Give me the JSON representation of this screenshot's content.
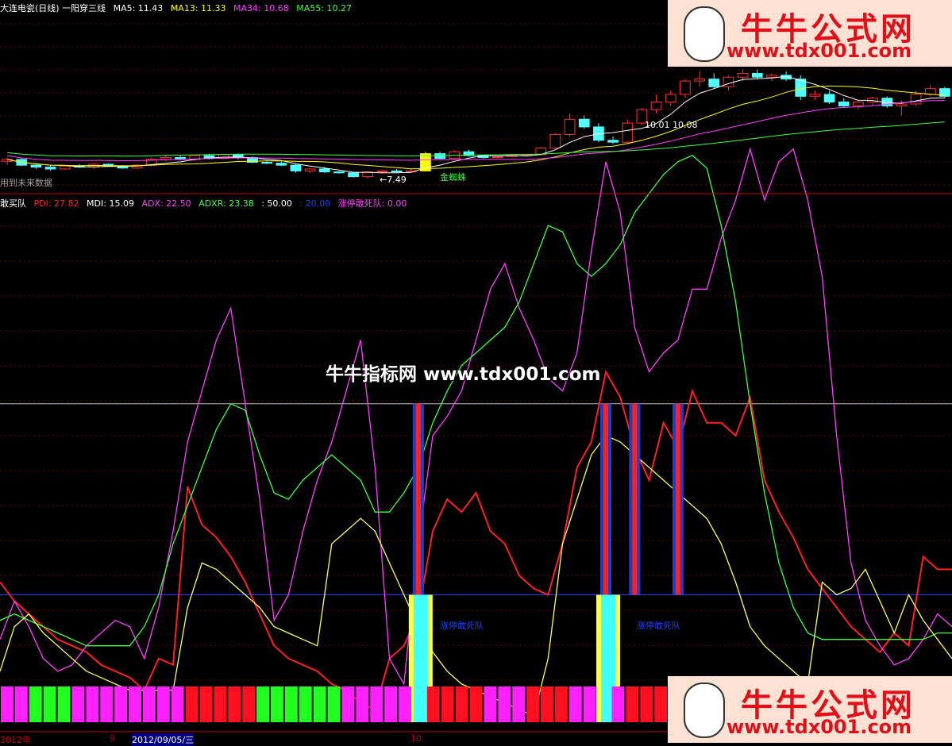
{
  "upper_header": {
    "title": "大连电瓷(日线) 一阳穿三线",
    "ma5": "MA5: 11.43",
    "ma13": "MA13: 11.33",
    "ma34": "MA34: 10.68",
    "ma55": "MA55: 10.27"
  },
  "lower_header": {
    "name": "敢买队",
    "pdi": "PDI: 27.82",
    "mdi": "MDI: 15.09",
    "adx": "ADX: 22.50",
    "adxr": "ADXR: 23.38",
    "v50": ": 50.00",
    "v20": ": 20.00",
    "zt": "涨停敢死队: 0.00"
  },
  "note": "用到未来数据",
  "annotations": {
    "low_price": "←7.49",
    "spider": "金蜘蛛",
    "price_mark": "10.01 10.08",
    "zt_label_1": "涨停敢死队",
    "zt_label_2": "涨停敢死队"
  },
  "watermark": "牛牛指标网 www.tdx001.com",
  "logo": {
    "title": "牛牛公式网",
    "url": "www.tdx001.com"
  },
  "x_axis": {
    "year": "2012年",
    "m9": "9",
    "date": "2012/09/05/三",
    "m10": "10"
  },
  "colors": {
    "bg": "#000000",
    "pdi": "#ff2020",
    "mdi": "#ff40ff",
    "adx": "#40ff40",
    "adxr": "#ffff60",
    "ma5": "#ffffff",
    "ma13": "#ffff00",
    "ma34": "#ff40ff",
    "ma55": "#40ff40",
    "grid": "#800000"
  },
  "chart_data": [
    {
      "type": "candlestick",
      "title": "大连电瓷(日线) 一阳穿三线",
      "candles": [
        [
          8.1,
          8.3,
          7.9,
          8.2
        ],
        [
          8.2,
          8.3,
          7.85,
          7.9
        ],
        [
          7.9,
          8.0,
          7.7,
          7.8
        ],
        [
          7.8,
          7.9,
          7.6,
          7.7
        ],
        [
          7.7,
          7.9,
          7.65,
          7.85
        ],
        [
          7.85,
          7.95,
          7.75,
          7.8
        ],
        [
          7.8,
          8.0,
          7.7,
          7.95
        ],
        [
          7.95,
          8.0,
          7.8,
          7.85
        ],
        [
          7.85,
          7.9,
          7.7,
          7.75
        ],
        [
          7.75,
          7.95,
          7.7,
          7.9
        ],
        [
          7.9,
          8.3,
          7.85,
          8.2
        ],
        [
          8.2,
          8.4,
          8.1,
          8.3
        ],
        [
          8.3,
          8.4,
          8.15,
          8.2
        ],
        [
          8.2,
          8.45,
          8.15,
          8.4
        ],
        [
          8.4,
          8.5,
          8.2,
          8.25
        ],
        [
          8.25,
          8.5,
          8.2,
          8.45
        ],
        [
          8.45,
          8.5,
          8.2,
          8.3
        ],
        [
          8.3,
          8.35,
          8.0,
          8.05
        ],
        [
          8.05,
          8.15,
          7.95,
          8.0
        ],
        [
          8.0,
          8.1,
          7.85,
          7.9
        ],
        [
          7.9,
          8.0,
          7.5,
          7.6
        ],
        [
          7.6,
          7.75,
          7.5,
          7.7
        ],
        [
          7.7,
          7.8,
          7.5,
          7.55
        ],
        [
          7.55,
          7.6,
          7.45,
          7.5
        ],
        [
          7.5,
          7.55,
          7.25,
          7.3
        ],
        [
          7.3,
          7.6,
          7.2,
          7.55
        ],
        [
          7.55,
          7.65,
          7.45,
          7.6
        ],
        [
          7.6,
          7.7,
          7.49,
          7.55
        ],
        [
          7.55,
          7.7,
          7.5,
          7.6
        ],
        [
          7.6,
          8.6,
          7.6,
          8.5
        ],
        [
          8.5,
          8.6,
          8.2,
          8.25
        ],
        [
          8.25,
          8.7,
          8.2,
          8.6
        ],
        [
          8.6,
          8.7,
          8.35,
          8.4
        ],
        [
          8.4,
          8.45,
          8.25,
          8.3
        ],
        [
          8.3,
          8.4,
          8.25,
          8.35
        ],
        [
          8.35,
          8.45,
          8.3,
          8.4
        ],
        [
          8.4,
          8.5,
          8.35,
          8.45
        ],
        [
          8.45,
          8.85,
          8.4,
          8.8
        ],
        [
          8.8,
          9.6,
          8.75,
          9.5
        ],
        [
          9.5,
          10.6,
          9.4,
          10.3
        ],
        [
          10.3,
          10.5,
          9.8,
          9.9
        ],
        [
          9.9,
          10.1,
          9.1,
          9.2
        ],
        [
          9.2,
          9.4,
          9.0,
          9.1
        ],
        [
          9.1,
          10.3,
          9.05,
          10.1
        ],
        [
          10.1,
          10.9,
          10.0,
          10.8
        ],
        [
          10.8,
          11.6,
          10.6,
          11.2
        ],
        [
          11.2,
          11.8,
          11.0,
          11.6
        ],
        [
          11.6,
          12.4,
          11.4,
          12.3
        ],
        [
          12.3,
          12.8,
          12.0,
          12.4
        ],
        [
          12.4,
          12.7,
          11.9,
          12.0
        ],
        [
          12.0,
          12.6,
          11.8,
          12.5
        ],
        [
          12.5,
          12.9,
          12.3,
          12.7
        ],
        [
          12.7,
          12.9,
          12.4,
          12.5
        ],
        [
          12.5,
          12.7,
          12.3,
          12.6
        ],
        [
          12.6,
          12.8,
          12.3,
          12.4
        ],
        [
          12.4,
          12.6,
          11.3,
          11.5
        ],
        [
          11.5,
          11.8,
          11.3,
          11.6
        ],
        [
          11.6,
          11.8,
          11.1,
          11.2
        ],
        [
          11.2,
          11.4,
          10.9,
          11.0
        ],
        [
          11.0,
          11.3,
          10.8,
          11.2
        ],
        [
          11.2,
          11.5,
          11.0,
          11.4
        ],
        [
          11.4,
          11.5,
          10.9,
          11.0
        ],
        [
          11.0,
          11.3,
          10.5,
          11.1
        ],
        [
          11.1,
          11.8,
          11.0,
          11.6
        ],
        [
          11.6,
          12.1,
          11.5,
          11.9
        ],
        [
          11.9,
          12.0,
          11.4,
          11.5
        ]
      ],
      "spider_index": 29
    },
    {
      "type": "line",
      "title": "敢买队",
      "ylim": [
        0,
        80
      ],
      "reference_lines": [
        50,
        20
      ],
      "series": [
        {
          "name": "PDI",
          "values": [
            22,
            19,
            17,
            15,
            13,
            12,
            11,
            9,
            8,
            7,
            5,
            10,
            9,
            37,
            31,
            29,
            26,
            22,
            17,
            12,
            10,
            9,
            8,
            6,
            5,
            3,
            2,
            10,
            12,
            17,
            30,
            35,
            33,
            36,
            30,
            28,
            23,
            21,
            20,
            28,
            40,
            44,
            55,
            51,
            43,
            38,
            47,
            43,
            52,
            47,
            47,
            45,
            51,
            38,
            33,
            29,
            24,
            21,
            18,
            15,
            13,
            11,
            14,
            12,
            26,
            24,
            24
          ]
        },
        {
          "name": "MDI",
          "values": [
            13,
            19,
            15,
            10,
            8,
            9,
            12,
            14,
            16,
            15,
            10,
            18,
            30,
            44,
            52,
            60,
            65,
            50,
            35,
            16,
            20,
            30,
            38,
            44,
            52,
            60,
            40,
            10,
            6,
            28,
            45,
            48,
            52,
            60,
            68,
            72,
            65,
            60,
            54,
            52,
            58,
            74,
            88,
            80,
            62,
            55,
            58,
            60,
            68,
            68,
            76,
            82,
            90,
            82,
            88,
            90,
            82,
            70,
            45,
            25,
            16,
            12,
            9,
            10,
            13,
            17,
            15
          ]
        },
        {
          "name": "ADX",
          "values": [
            16,
            17,
            16,
            15,
            14,
            13,
            12,
            12,
            12,
            12,
            15,
            20,
            28,
            34,
            40,
            46,
            50,
            49,
            42,
            36,
            35,
            38,
            40,
            42,
            40,
            38,
            33,
            33,
            36,
            40,
            47,
            52,
            56,
            58,
            60,
            62,
            66,
            72,
            78,
            77,
            72,
            70,
            72,
            75,
            80,
            83,
            86,
            88,
            89,
            87,
            78,
            66,
            50,
            36,
            25,
            18,
            14,
            13,
            13,
            13,
            13,
            13,
            13,
            13,
            13,
            14,
            14
          ]
        },
        {
          "name": "ADXR",
          "values": [
            8,
            15,
            17,
            14,
            12,
            10,
            8,
            7,
            6,
            5,
            5,
            5,
            5,
            18,
            25,
            24,
            22,
            20,
            18,
            15,
            14,
            13,
            12,
            28,
            30,
            32,
            30,
            25,
            20,
            15,
            11,
            8,
            6,
            5,
            4,
            3,
            2,
            1,
            10,
            28,
            35,
            42,
            45,
            44,
            42,
            40,
            38,
            36,
            34,
            32,
            28,
            22,
            15,
            12,
            10,
            8,
            6,
            22,
            20,
            21,
            24,
            19,
            14,
            20,
            16,
            13,
            10
          ]
        }
      ],
      "zt_marks": [
        29,
        42,
        44,
        47
      ]
    }
  ]
}
